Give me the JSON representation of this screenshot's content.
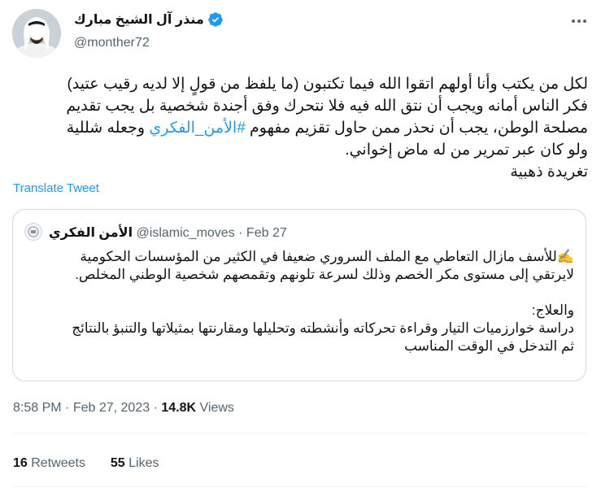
{
  "author": {
    "name": "منذر آل الشيخ مبارك",
    "handle": "@monther72",
    "verified_color": "#1d9bf0"
  },
  "tweet": {
    "lines": [
      "لكل من يكتب وأنا أولهم اتقوا الله فيما تكتبون (ما يلفظ من قولٍ إلا لديه رقيب عتيد)",
      "فكر الناس أمانه ويجب أن نتق الله فيه فلا نتحرك وفق أجندة شخصية بل يجب تقديم"
    ],
    "line3_prefix": "مصلحة الوطن، يجب أن نحذر ممن حاول تقزيم مفهوم",
    "hashtag": "#الأمن_الفكري",
    "line3_suffix": "وجعله شللية",
    "line4": "ولو كان عبر تمرير من له ماض إخواني.",
    "line5": "تغريدة ذهبية"
  },
  "translate_label": "Translate Tweet",
  "quote": {
    "name": "الأمن الفكري",
    "handle": "@islamic_moves",
    "separator": "·",
    "date": "Feb 27",
    "line1": "✍️للأسف مازال التعاطي مع الملف السروري ضعيفا في الكثير من المؤسسات الحكومية",
    "line2": "لايرتقي إلى مستوى مكر الخصم وذلك لسرعة تلونهم وتقمصهم شخصية الوطني المخلص.",
    "line3": "والعلاج:",
    "line4": "دراسة خوارزميات التيار وقراءة تحركاته وأنشطته وتحليلها ومقارنتها بمثيلاتها والتنبؤ بالنتائج",
    "line5": "ثم التدخل في الوقت المناسب"
  },
  "meta": {
    "time": "8:58 PM",
    "dot": "·",
    "date": "Feb 27, 2023",
    "views_count": "14.8K",
    "views_label": "Views"
  },
  "stats": {
    "retweets_count": "16",
    "retweets_label": "Retweets",
    "likes_count": "55",
    "likes_label": "Likes"
  }
}
